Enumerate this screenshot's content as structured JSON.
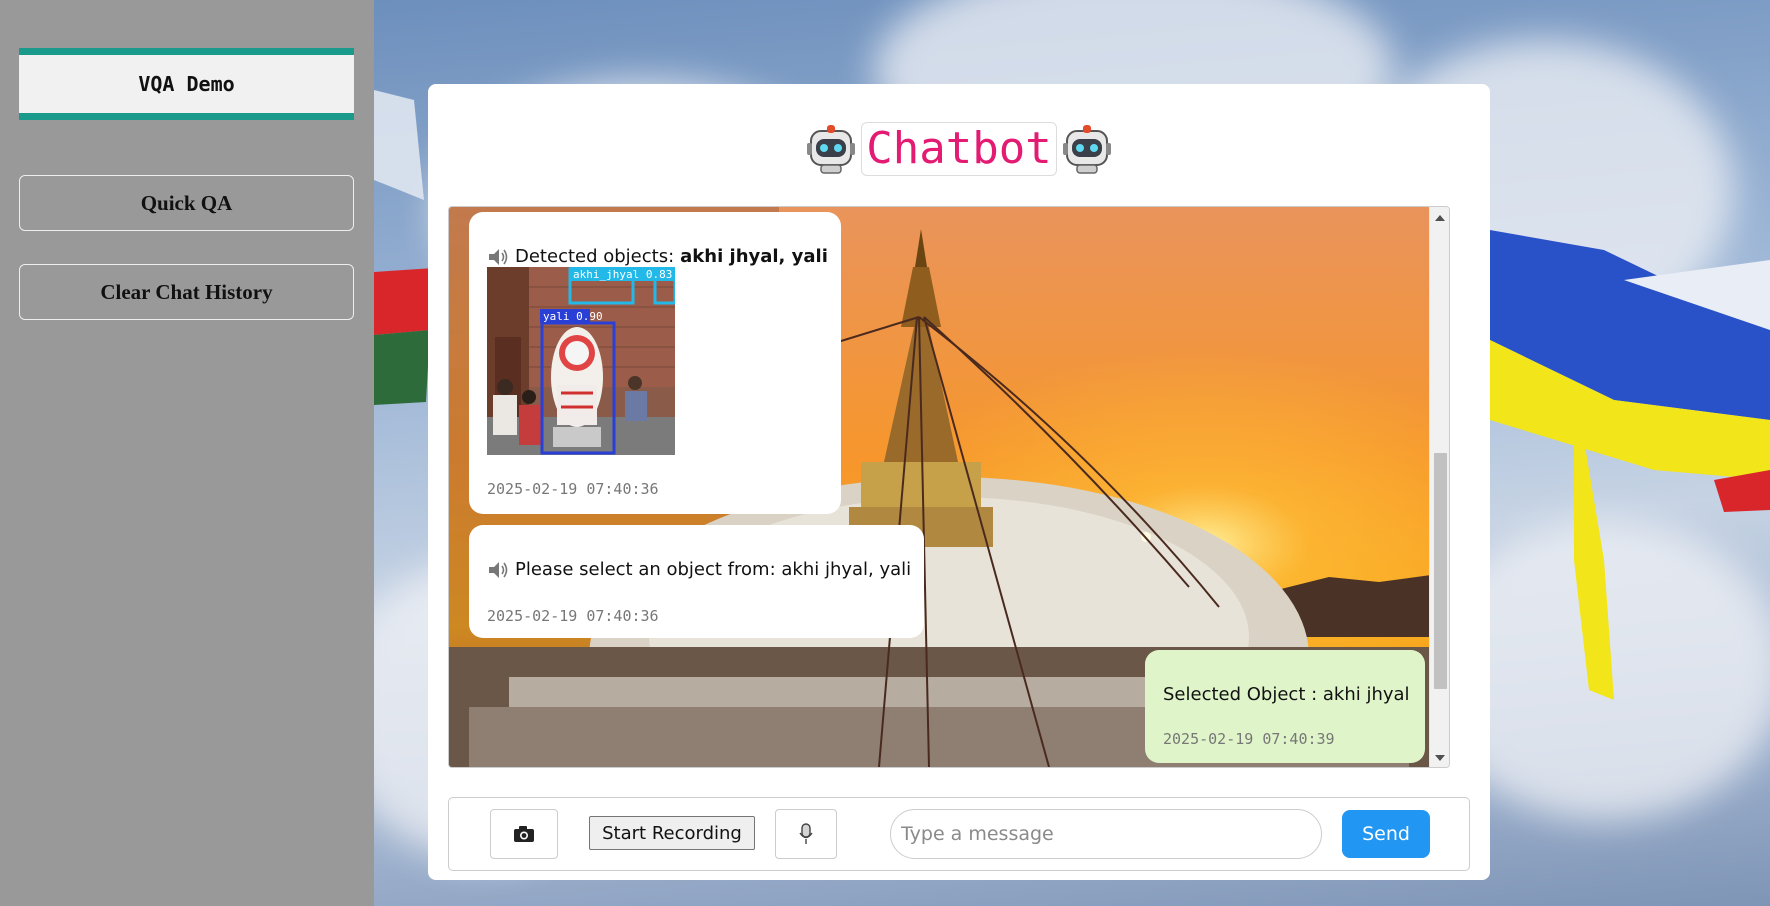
{
  "sidebar": {
    "brand": "VQA Demo",
    "quick_qa": "Quick QA",
    "clear_history": "Clear Chat History"
  },
  "header": {
    "title": "Chatbot",
    "icon": "robot-icon"
  },
  "messages": [
    {
      "sender": "bot",
      "prefix": "Detected objects: ",
      "bold": "akhi jhyal, yali",
      "image_labels": [
        "akhi_jhyal 0.83",
        "yali 0.90"
      ],
      "timestamp": "2025-02-19 07:40:36"
    },
    {
      "sender": "bot",
      "text": "Please select an object from: akhi jhyal, yali",
      "timestamp": "2025-02-19 07:40:36"
    },
    {
      "sender": "user",
      "text": "Selected Object : akhi jhyal",
      "timestamp": "2025-02-19 07:40:39"
    }
  ],
  "input_bar": {
    "camera_icon": "camera-icon",
    "record_label": "Start Recording",
    "mic_icon": "microphone-icon",
    "placeholder": "Type a message",
    "send_label": "Send"
  },
  "colors": {
    "accent_teal": "#1a9a8a",
    "title_pink": "#e31b73",
    "send_blue": "#2196f3",
    "user_bubble": "#dff5c9"
  }
}
